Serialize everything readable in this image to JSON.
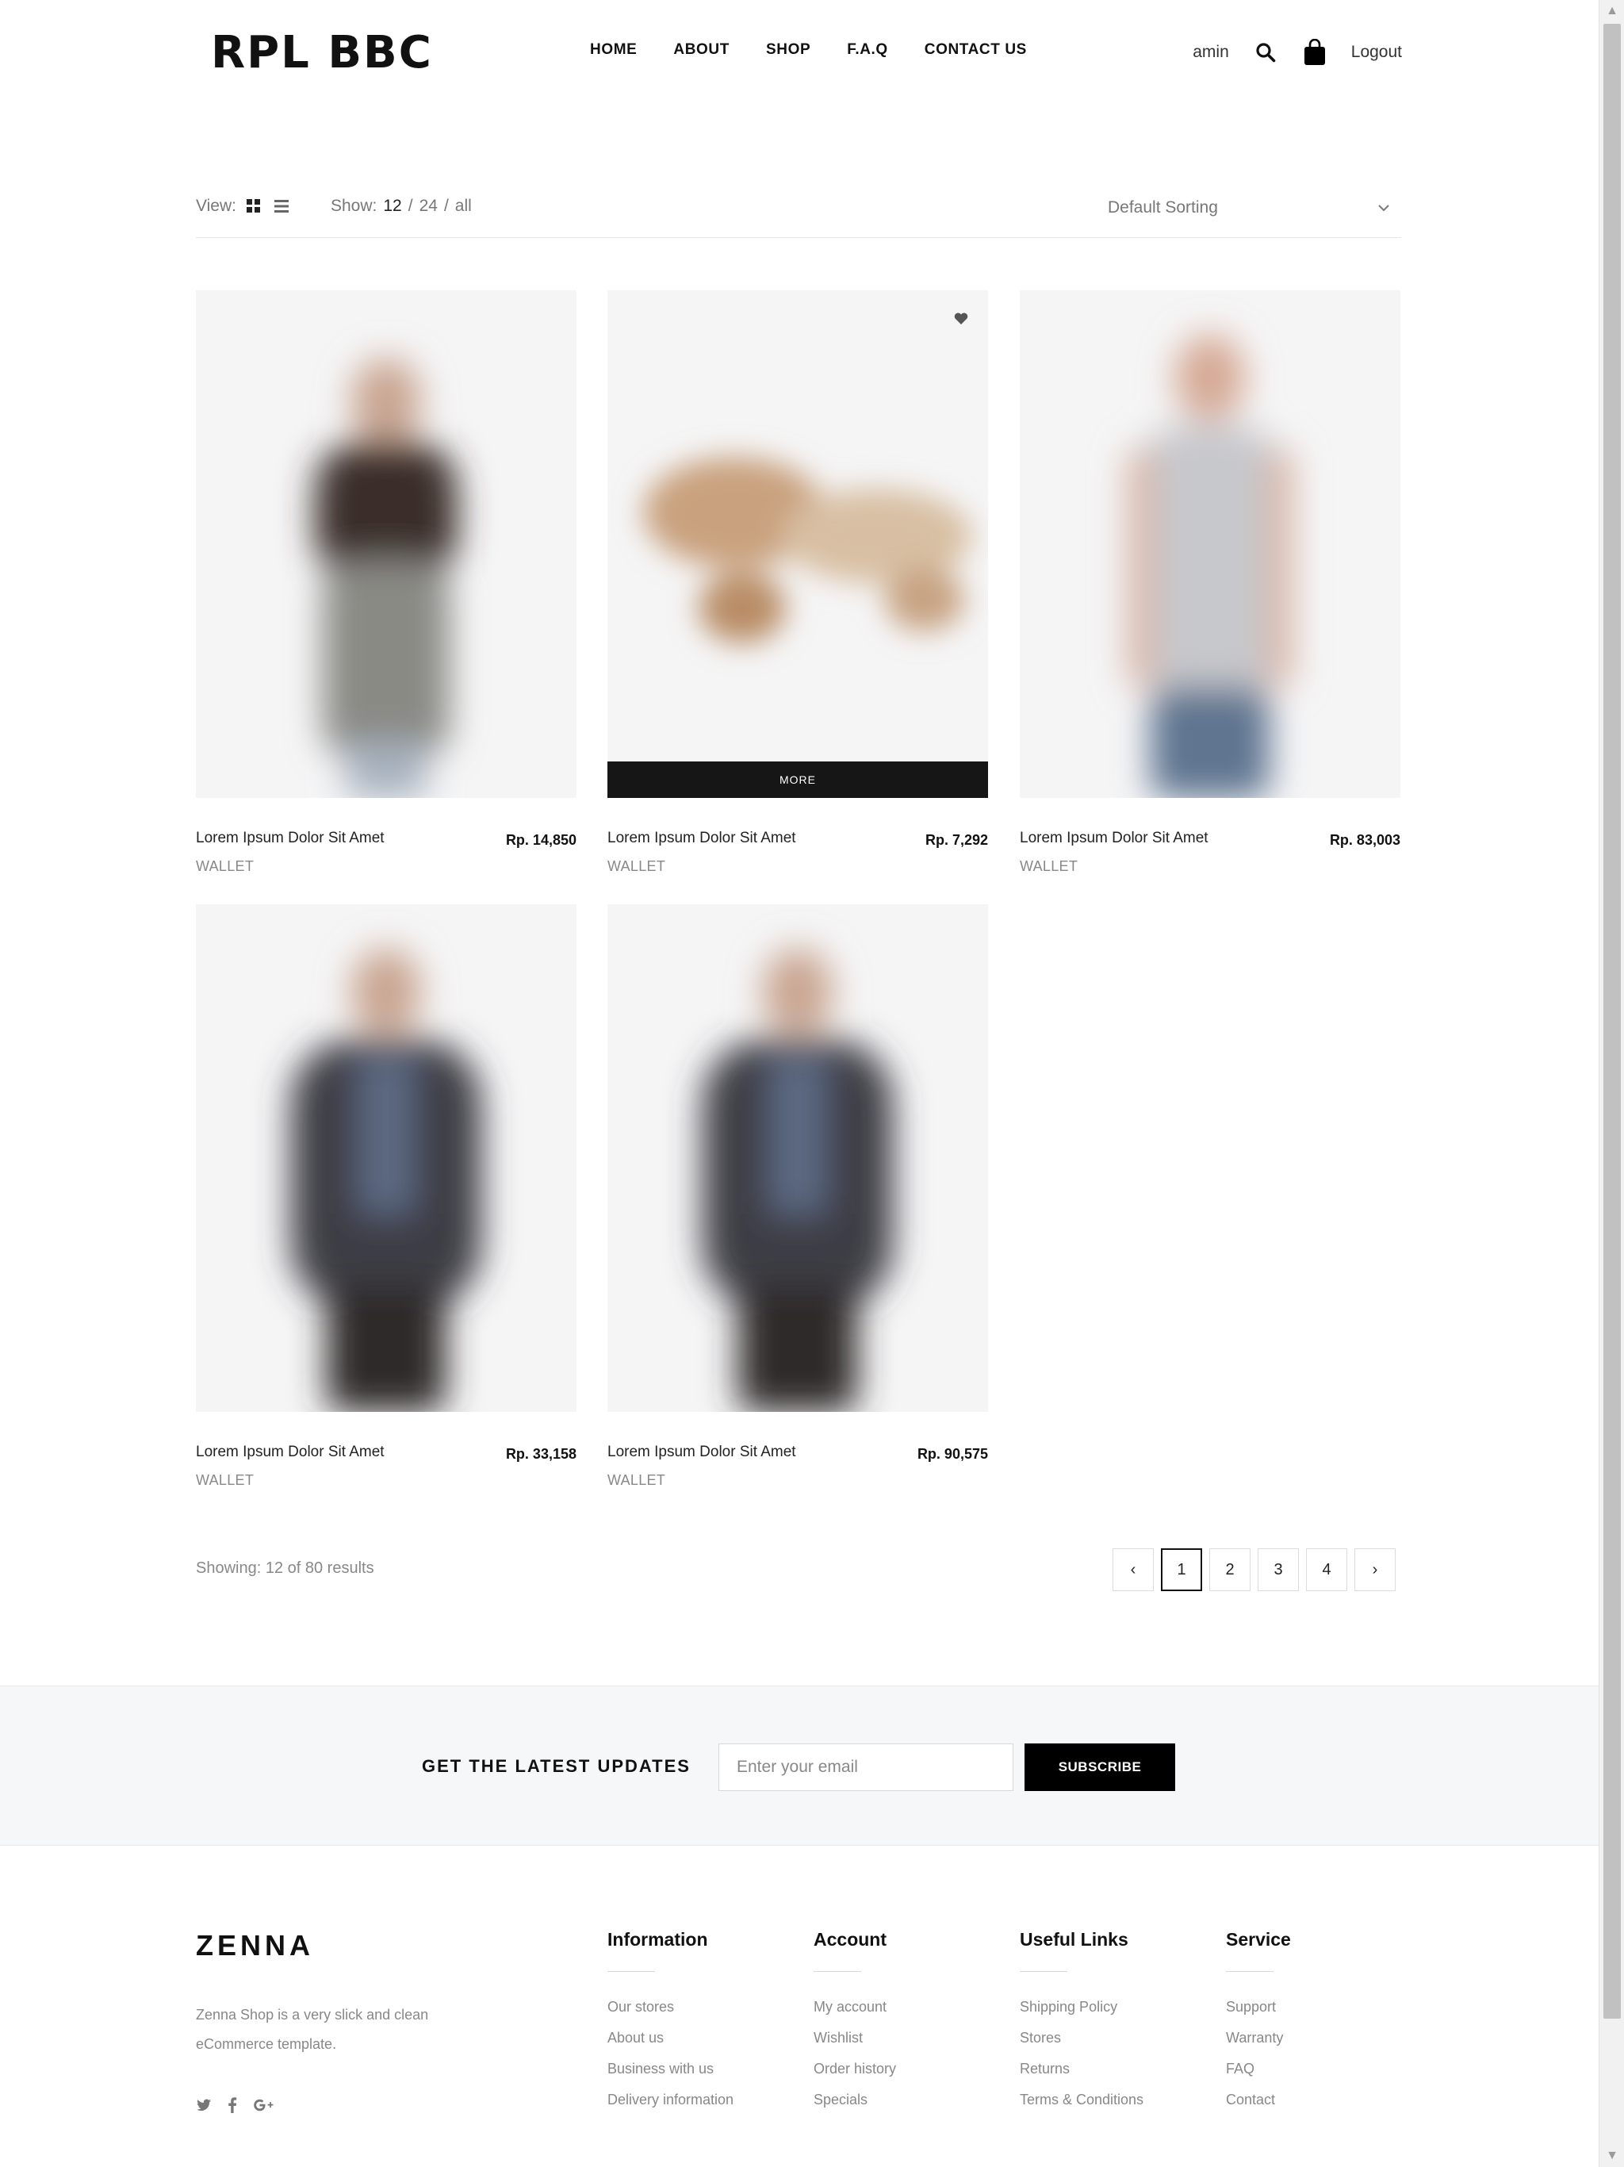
{
  "header": {
    "logo": "RPL BBC",
    "nav": [
      "HOME",
      "ABOUT",
      "SHOP",
      "F.A.Q",
      "CONTACT US"
    ],
    "user": "amin",
    "icons": [
      "search-icon",
      "shopping-bag-icon"
    ],
    "logout": "Logout"
  },
  "toolbar": {
    "view_label": "View:",
    "view_modes": [
      "grid-view-icon",
      "list-view-icon"
    ],
    "show_label": "Show:",
    "show_options": [
      "12",
      "24",
      "all"
    ],
    "show_active": "12",
    "sep": "/",
    "sorting": "Default Sorting"
  },
  "products": [
    {
      "name": "Lorem Ipsum Dolor Sit Amet",
      "price": "Rp. 14,850",
      "category": "WALLET"
    },
    {
      "name": "Lorem Ipsum Dolor Sit Amet",
      "price": "Rp. 7,292",
      "category": "WALLET",
      "more_label": "MORE"
    },
    {
      "name": "Lorem Ipsum Dolor Sit Amet",
      "price": "Rp. 83,003",
      "category": "WALLET"
    },
    {
      "name": "Lorem Ipsum Dolor Sit Amet",
      "price": "Rp. 33,158",
      "category": "WALLET"
    },
    {
      "name": "Lorem Ipsum Dolor Sit Amet",
      "price": "Rp. 90,575",
      "category": "WALLET"
    }
  ],
  "results": "Showing: 12 of 80 results",
  "pagination": {
    "prev": "‹",
    "pages": [
      "1",
      "2",
      "3",
      "4"
    ],
    "active": "1",
    "next": "›"
  },
  "newsletter": {
    "title": "GET THE LATEST UPDATES",
    "placeholder": "Enter your email",
    "button": "SUBSCRIBE"
  },
  "footer": {
    "logo": "ZENNA",
    "description": "Zenna Shop is a very slick and clean eCommerce template.",
    "social": [
      "twitter-icon",
      "facebook-icon",
      "google-plus-icon"
    ],
    "columns": [
      {
        "title": "Information",
        "links": [
          "Our stores",
          "About us",
          "Business with us",
          "Delivery information"
        ]
      },
      {
        "title": "Account",
        "links": [
          "My account",
          "Wishlist",
          "Order history",
          "Specials"
        ]
      },
      {
        "title": "Useful Links",
        "links": [
          "Shipping Policy",
          "Stores",
          "Returns",
          "Terms & Conditions"
        ]
      },
      {
        "title": "Service",
        "links": [
          "Support",
          "Warranty",
          "FAQ",
          "Contact"
        ]
      }
    ]
  }
}
